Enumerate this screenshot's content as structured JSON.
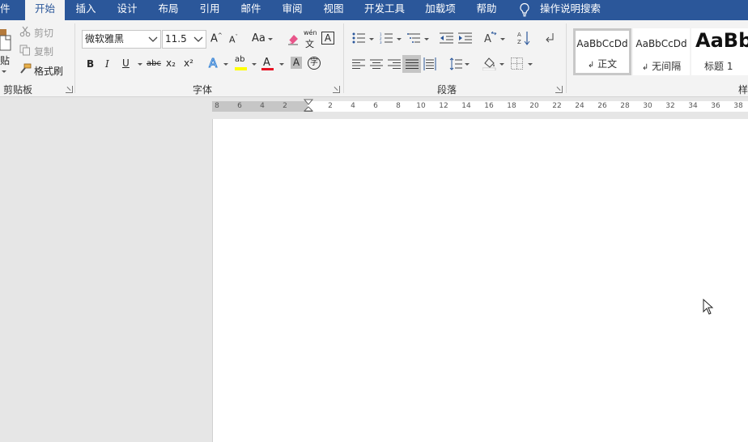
{
  "ribbon_tabs": [
    "件",
    "开始",
    "插入",
    "设计",
    "布局",
    "引用",
    "邮件",
    "审阅",
    "视图",
    "开发工具",
    "加载项",
    "帮助"
  ],
  "tell_me": "操作说明搜索",
  "clipboard": {
    "paste_fragment": "贴",
    "cut": "剪切",
    "copy": "复制",
    "format_painter": "格式刷",
    "group_label": "剪贴板"
  },
  "font": {
    "family": "微软雅黑",
    "size": "11.5",
    "change_case": "Aa",
    "phonetic_top": "wén",
    "phonetic_bottom": "文",
    "char_border": "A",
    "bold": "B",
    "italic": "I",
    "underline": "U",
    "strikethrough": "abc",
    "subscript": "x₂",
    "superscript": "x²",
    "text_effects": "A",
    "highlight": "ab",
    "font_color": "A",
    "char_shading": "A",
    "enclose": "字",
    "group_label": "字体",
    "highlight_color": "#ffff00",
    "font_color_value": "#e81123"
  },
  "paragraph": {
    "group_label": "段落"
  },
  "styles": {
    "items": [
      {
        "preview": "AaBbCcDd",
        "name": "正文",
        "marker": "↲"
      },
      {
        "preview": "AaBbCcDd",
        "name": "无间隔",
        "marker": "↲"
      },
      {
        "preview": "AaBb",
        "name": "标题 1",
        "marker": ""
      }
    ],
    "group_label": "样"
  },
  "ruler": {
    "left_labels": [
      "8",
      "6",
      "4",
      "2"
    ],
    "right_labels": [
      "2",
      "4",
      "6",
      "8",
      "10",
      "12",
      "14",
      "16",
      "18",
      "20",
      "22",
      "24",
      "26",
      "28",
      "30",
      "32",
      "34",
      "36",
      "38"
    ]
  },
  "colors": {
    "ribbon_blue": "#2b579a",
    "ribbon_body": "#f3f3f3",
    "canvas": "#e6e6e6"
  }
}
